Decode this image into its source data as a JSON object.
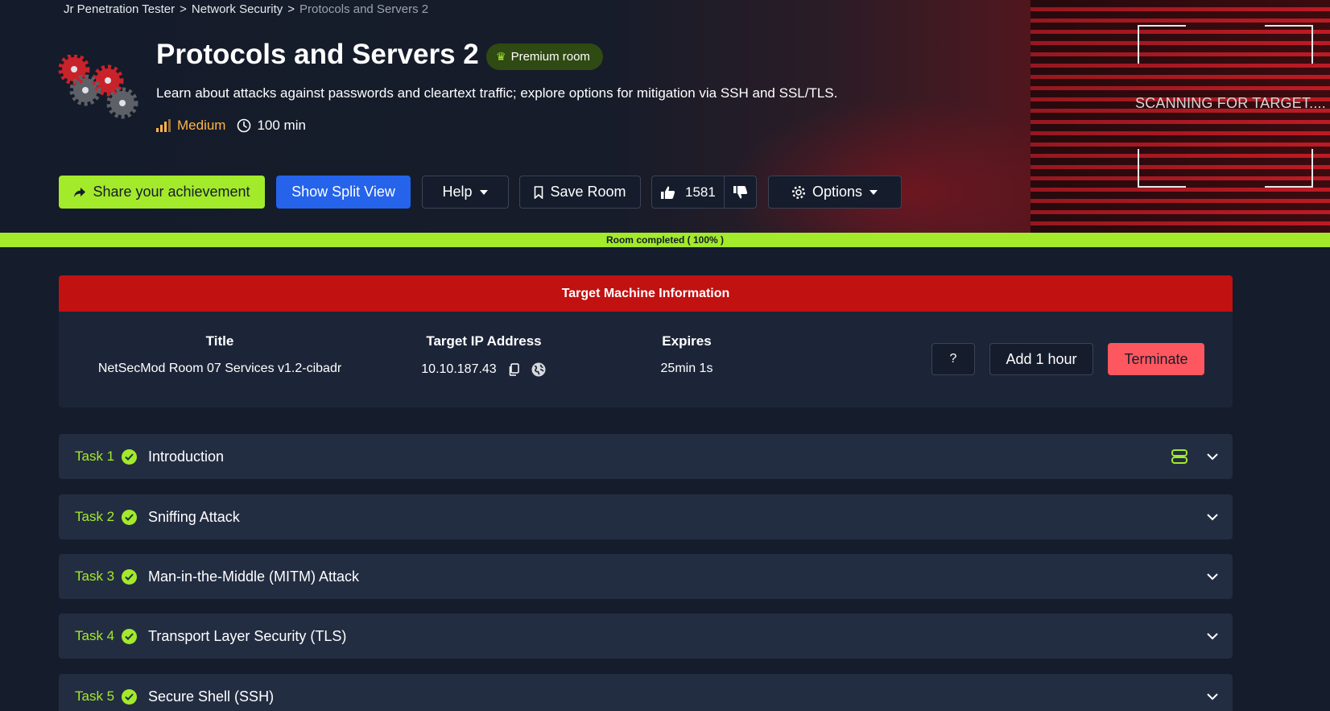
{
  "breadcrumb": {
    "item1": "Jr Penetration Tester",
    "item2": "Network Security",
    "current": "Protocols and Servers 2",
    "separator": ">"
  },
  "room": {
    "title": "Protocols and Servers 2",
    "premium_label": "Premium room",
    "description": "Learn about attacks against passwords and cleartext traffic; explore options for mitigation via SSH and SSL/TLS.",
    "difficulty": "Medium",
    "duration": "100 min",
    "scanning_text": "SCANNING FOR TARGET...."
  },
  "actions": {
    "share_label": "Share your achievement",
    "split_label": "Show Split View",
    "help_label": "Help",
    "save_label": "Save Room",
    "likes": "1581",
    "options_label": "Options"
  },
  "progress": {
    "label": "Room completed ( 100% )",
    "percent": 100
  },
  "target_machine": {
    "header": "Target Machine Information",
    "title_heading": "Title",
    "title_value": "NetSecMod Room 07 Services v1.2-cibadr",
    "ip_heading": "Target IP Address",
    "ip_value": "10.10.187.43",
    "expires_heading": "Expires",
    "expires_value": "25min 1s",
    "help_label": "?",
    "add_hour_label": "Add 1 hour",
    "terminate_label": "Terminate"
  },
  "tasks": [
    {
      "number": "Task 1",
      "title": "Introduction"
    },
    {
      "number": "Task 2",
      "title": "Sniffing Attack"
    },
    {
      "number": "Task 3",
      "title": "Man-in-the-Middle (MITM) Attack"
    },
    {
      "number": "Task 4",
      "title": "Transport Layer Security (TLS)"
    },
    {
      "number": "Task 5",
      "title": "Secure Shell (SSH)"
    }
  ],
  "colors": {
    "accent": "#a3ea2a",
    "primary": "#2563eb",
    "danger": "#c11111",
    "terminate": "#ff575f",
    "difficulty": "#ffb547",
    "background": "#151c2b",
    "card": "#232d42"
  }
}
